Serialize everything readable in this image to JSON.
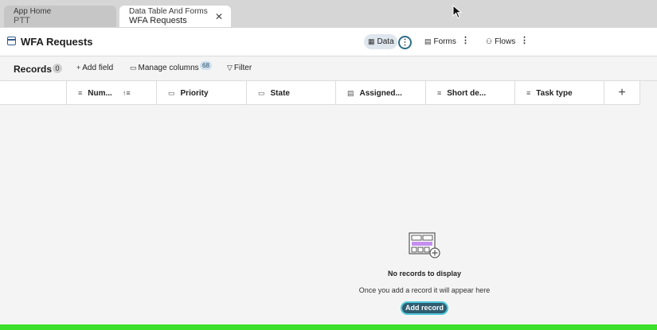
{
  "tabs": [
    {
      "line1": "App Home",
      "line2": "PTT"
    },
    {
      "line1": "Data Table And Forms",
      "line2": "WFA Requests",
      "close": "✕"
    }
  ],
  "header": {
    "title": "WFA Requests",
    "views": {
      "data": "Data",
      "forms": "Forms",
      "flows": "Flows"
    }
  },
  "toolbar": {
    "records_label": "Records",
    "records_count": "0",
    "add_field": "Add field",
    "manage_columns": "Manage columns",
    "manage_columns_badge": "68",
    "filter": "Filter"
  },
  "columns": [
    {
      "label": "Num...",
      "icon": "text-lines-icon"
    },
    {
      "label": "Priority",
      "icon": "choice-icon"
    },
    {
      "label": "State",
      "icon": "choice-icon"
    },
    {
      "label": "Assigned...",
      "icon": "reference-icon"
    },
    {
      "label": "Short de...",
      "icon": "text-lines-icon"
    },
    {
      "label": "Task type",
      "icon": "text-lines-icon"
    }
  ],
  "empty_state": {
    "title": "No records to display",
    "subtitle": "Once you add a record it will appear here",
    "button": "Add record"
  },
  "colors": {
    "accent": "#2f5c6f",
    "focus_ring": "#4ec7d9",
    "highlight": "#3ce02a"
  }
}
